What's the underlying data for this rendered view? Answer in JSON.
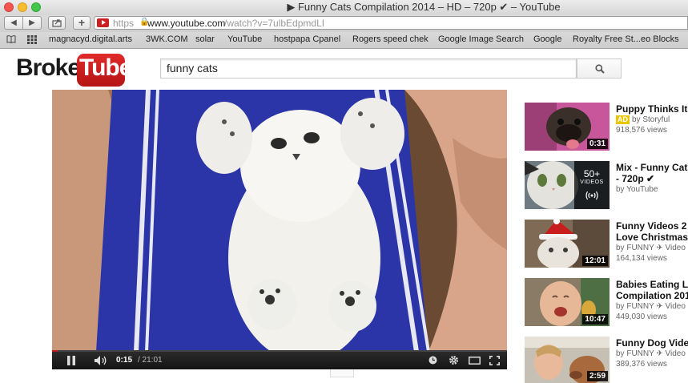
{
  "window": {
    "title": "▶ Funny Cats Compilation 2014 – HD – 720p ✔ – YouTube"
  },
  "toolbar": {
    "url_scheme": "https",
    "url_host": "www.youtube.com",
    "url_path": "/watch?v=7ulbEdpmdLI"
  },
  "bookmarks": [
    "magnacyd.digital.arts",
    "3WK.COM",
    "solar",
    "YouTube",
    "hostpapa Cpanel",
    "Rogers speed chek",
    "Google Image Search",
    "Google",
    "Royalty Free St...eo Blocks"
  ],
  "header": {
    "logo_part1": "Broken",
    "logo_part2": "Tube",
    "search_value": "funny cats"
  },
  "player": {
    "current_time": "0:15",
    "total_time": "/ 21:01",
    "progress": 0.012
  },
  "recommendations": [
    {
      "title": "Puppy Thinks It",
      "ad_badge": "AD",
      "by": "by Storyful",
      "views": "918,576 views",
      "duration": "0:31"
    },
    {
      "title": "Mix - Funny Cat",
      "title2": "- 720p ✔",
      "by": "by YouTube",
      "mix_count": "50+",
      "mix_label": "VIDEOS"
    },
    {
      "title": "Funny Videos 2",
      "title2": "Love Christmas",
      "by": "by FUNNY ✈ Video",
      "views": "164,134 views",
      "duration": "12:01"
    },
    {
      "title": "Babies Eating L",
      "title2": "Compilation 201",
      "by": "by FUNNY ✈ Video",
      "views": "449,030 views",
      "duration": "10:47"
    },
    {
      "title": "Funny Dog Vide",
      "by": "by FUNNY ✈ Video",
      "views": "389,376 views",
      "duration": "2:59"
    }
  ],
  "colors": {
    "brand_red": "#cc181e",
    "ad_yellow": "#e8c700"
  }
}
